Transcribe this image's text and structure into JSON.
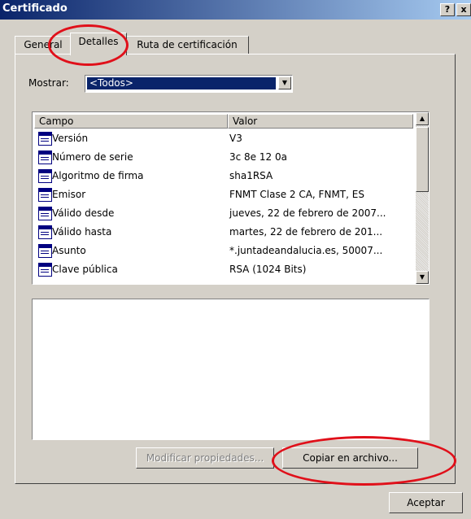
{
  "window": {
    "title": "Certificado",
    "help_label": "?",
    "close_label": "x"
  },
  "tabs": [
    {
      "label": "General"
    },
    {
      "label": "Detalles"
    },
    {
      "label": "Ruta de certificación"
    }
  ],
  "filter": {
    "label": "Mostrar:",
    "value": "<Todos>"
  },
  "table": {
    "headers": [
      "Campo",
      "Valor"
    ],
    "rows": [
      {
        "field": "Versión",
        "value": "V3"
      },
      {
        "field": "Número de serie",
        "value": "3c 8e 12 0a"
      },
      {
        "field": "Algoritmo de firma",
        "value": "sha1RSA"
      },
      {
        "field": "Emisor",
        "value": "FNMT Clase 2 CA, FNMT, ES"
      },
      {
        "field": "Válido desde",
        "value": "jueves, 22 de febrero de 2007..."
      },
      {
        "field": "Válido hasta",
        "value": "martes, 22 de febrero de 201..."
      },
      {
        "field": "Asunto",
        "value": "*.juntadeandalucia.es, 50007..."
      },
      {
        "field": "Clave pública",
        "value": "RSA (1024 Bits)"
      }
    ]
  },
  "buttons": {
    "edit": "Modificar propiedades...",
    "copy": "Copiar en archivo...",
    "ok": "Aceptar"
  },
  "colors": {
    "title_bar": "#0a246a",
    "highlight": "#0a246a",
    "annotation": "#e0101a"
  }
}
